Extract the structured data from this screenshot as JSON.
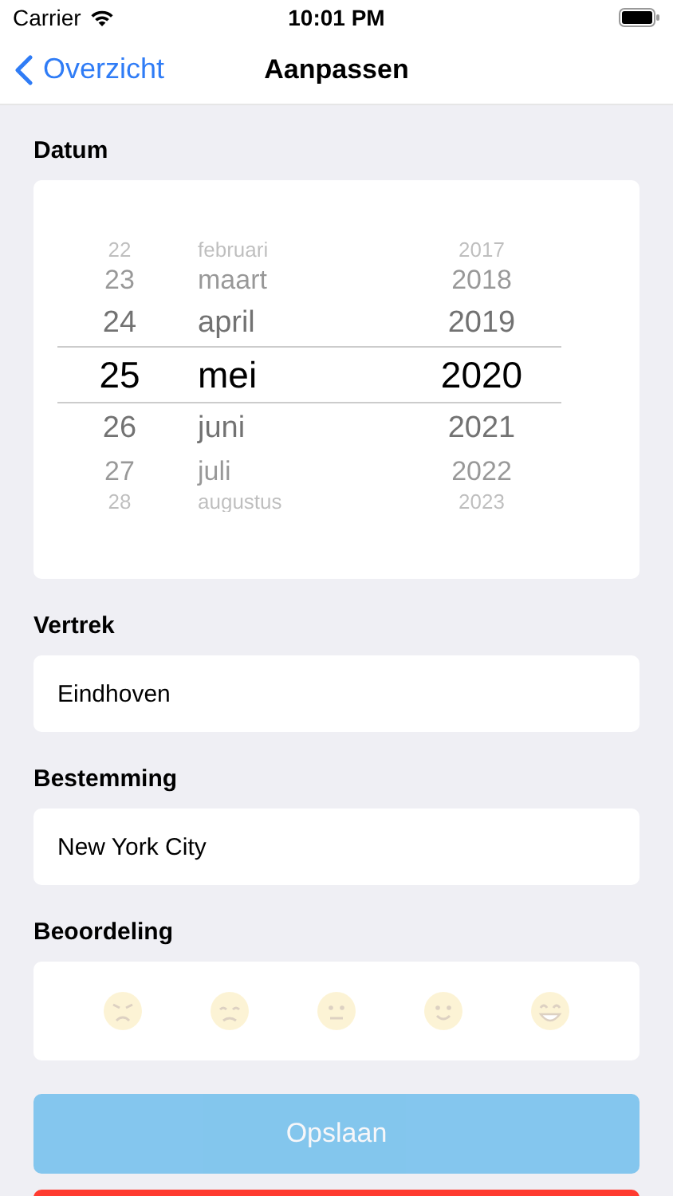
{
  "status_bar": {
    "carrier": "Carrier",
    "time": "10:01 PM"
  },
  "nav": {
    "back": "Overzicht",
    "title": "Aanpassen"
  },
  "date": {
    "label": "Datum",
    "rows": [
      {
        "day": "22",
        "month": "februari",
        "year": "2017",
        "selected": false
      },
      {
        "day": "23",
        "month": "maart",
        "year": "2018",
        "selected": false
      },
      {
        "day": "24",
        "month": "april",
        "year": "2019",
        "selected": false
      },
      {
        "day": "25",
        "month": "mei",
        "year": "2020",
        "selected": true
      },
      {
        "day": "26",
        "month": "juni",
        "year": "2021",
        "selected": false
      },
      {
        "day": "27",
        "month": "juli",
        "year": "2022",
        "selected": false
      },
      {
        "day": "28",
        "month": "augustus",
        "year": "2023",
        "selected": false
      }
    ]
  },
  "departure": {
    "label": "Vertrek",
    "value": "Eindhoven"
  },
  "destination": {
    "label": "Bestemming",
    "value": "New York City"
  },
  "rating": {
    "label": "Beoordeling",
    "options": [
      {
        "kind": "angry",
        "selected": false
      },
      {
        "kind": "sad",
        "selected": false
      },
      {
        "kind": "neutral",
        "selected": false
      },
      {
        "kind": "smile",
        "selected": false
      },
      {
        "kind": "grin",
        "selected": false
      }
    ]
  },
  "buttons": [
    {
      "kind": "save",
      "label": "Opslaan",
      "disabled": true
    },
    {
      "kind": "delete"
    }
  ]
}
